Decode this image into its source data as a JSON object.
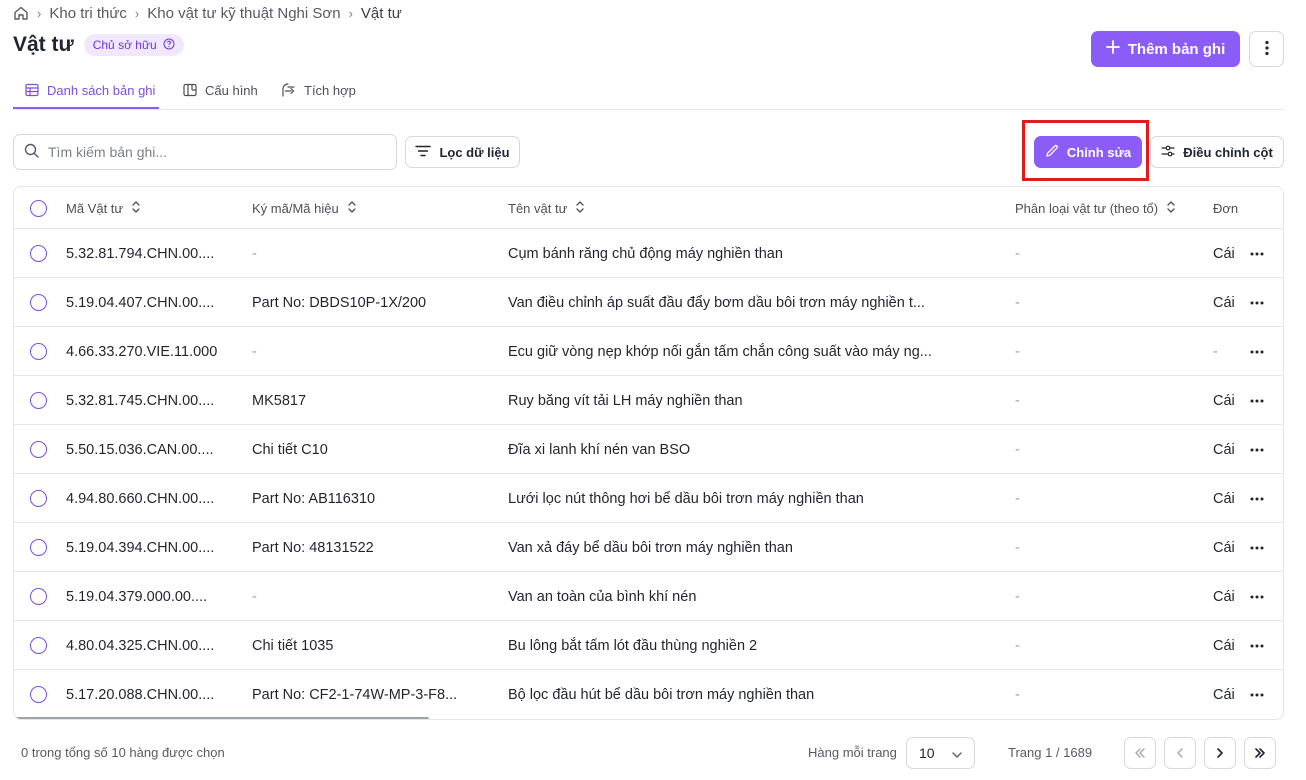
{
  "breadcrumb": {
    "items": [
      "Kho tri thức",
      "Kho vật tư kỹ thuật Nghi Sơn"
    ],
    "current": "Vật tư",
    "home_icon": "home-icon",
    "separator_icon": "chevron-right-icon"
  },
  "header": {
    "title": "Vật tư",
    "owner_badge": "Chủ sở hữu",
    "add_button": "Thêm bản ghi"
  },
  "tabs": [
    {
      "label": "Danh sách bản ghi",
      "active": true,
      "icon": "table-icon"
    },
    {
      "label": "Cấu hình",
      "active": false,
      "icon": "layout-icon"
    },
    {
      "label": "Tích hợp",
      "active": false,
      "icon": "integration-icon"
    }
  ],
  "toolbar": {
    "search_placeholder": "Tìm kiếm bản ghi...",
    "filter_label": "Lọc dữ liệu",
    "edit_label": "Chỉnh sửa",
    "columns_label": "Điều chỉnh cột"
  },
  "table": {
    "columns": [
      "Mã Vật tư",
      "Ký mã/Mã hiệu",
      "Tên vật tư",
      "Phân loại vật tư (theo tổ)",
      "Đơn"
    ],
    "rows": [
      {
        "code": "5.32.81.794.CHN.00....",
        "symbol": "-",
        "name": "Cụm bánh răng chủ động máy nghiền than",
        "category": "-",
        "unit": "Cái"
      },
      {
        "code": "5.19.04.407.CHN.00....",
        "symbol": "Part No: DBDS10P-1X/200",
        "name": "Van điều chỉnh áp suất đầu đẩy bơm dầu bôi trơn máy nghiền t...",
        "category": "-",
        "unit": "Cái"
      },
      {
        "code": "4.66.33.270.VIE.11.000",
        "symbol": "-",
        "name": "Ecu giữ vòng nẹp khớp nối gắn tấm chắn công suất vào máy ng...",
        "category": "-",
        "unit": "-"
      },
      {
        "code": "5.32.81.745.CHN.00....",
        "symbol": "MK5817",
        "name": "Ruy băng vít tải LH máy nghiền than",
        "category": "-",
        "unit": "Cái"
      },
      {
        "code": "5.50.15.036.CAN.00....",
        "symbol": "Chi tiết C10",
        "name": "Đĩa xi lanh khí nén van BSO",
        "category": "-",
        "unit": "Cái"
      },
      {
        "code": "4.94.80.660.CHN.00....",
        "symbol": "Part No: AB116310",
        "name": "Lưới lọc nút thông hơi bể dầu bôi trơn máy nghiền than",
        "category": "-",
        "unit": "Cái"
      },
      {
        "code": "5.19.04.394.CHN.00....",
        "symbol": "Part No: 48131522",
        "name": "Van xả đáy bể dầu bôi trơn máy nghiền than",
        "category": "-",
        "unit": "Cái"
      },
      {
        "code": "5.19.04.379.000.00....",
        "symbol": "-",
        "name": "Van an toàn của bình khí nén",
        "category": "-",
        "unit": "Cái"
      },
      {
        "code": "4.80.04.325.CHN.00....",
        "symbol": "Chi tiết 1035",
        "name": "Bu lông bắt tấm lót đầu thùng nghiền 2",
        "category": "-",
        "unit": "Cái"
      },
      {
        "code": "5.17.20.088.CHN.00....",
        "symbol": "Part No: CF2-1-74W-MP-3-F8...",
        "name": "Bộ lọc đầu hút bể dầu bôi trơn máy nghiền than",
        "category": "-",
        "unit": "Cái"
      }
    ]
  },
  "footer": {
    "selection_text": "0 trong tổng số 10 hàng được chọn",
    "rows_per_page_label": "Hàng mỗi trang",
    "rows_per_page_value": "10",
    "page_info": "Trang 1 / 1689"
  },
  "colors": {
    "accent": "#8b5cf6",
    "highlight_box": "#e01b1b"
  }
}
